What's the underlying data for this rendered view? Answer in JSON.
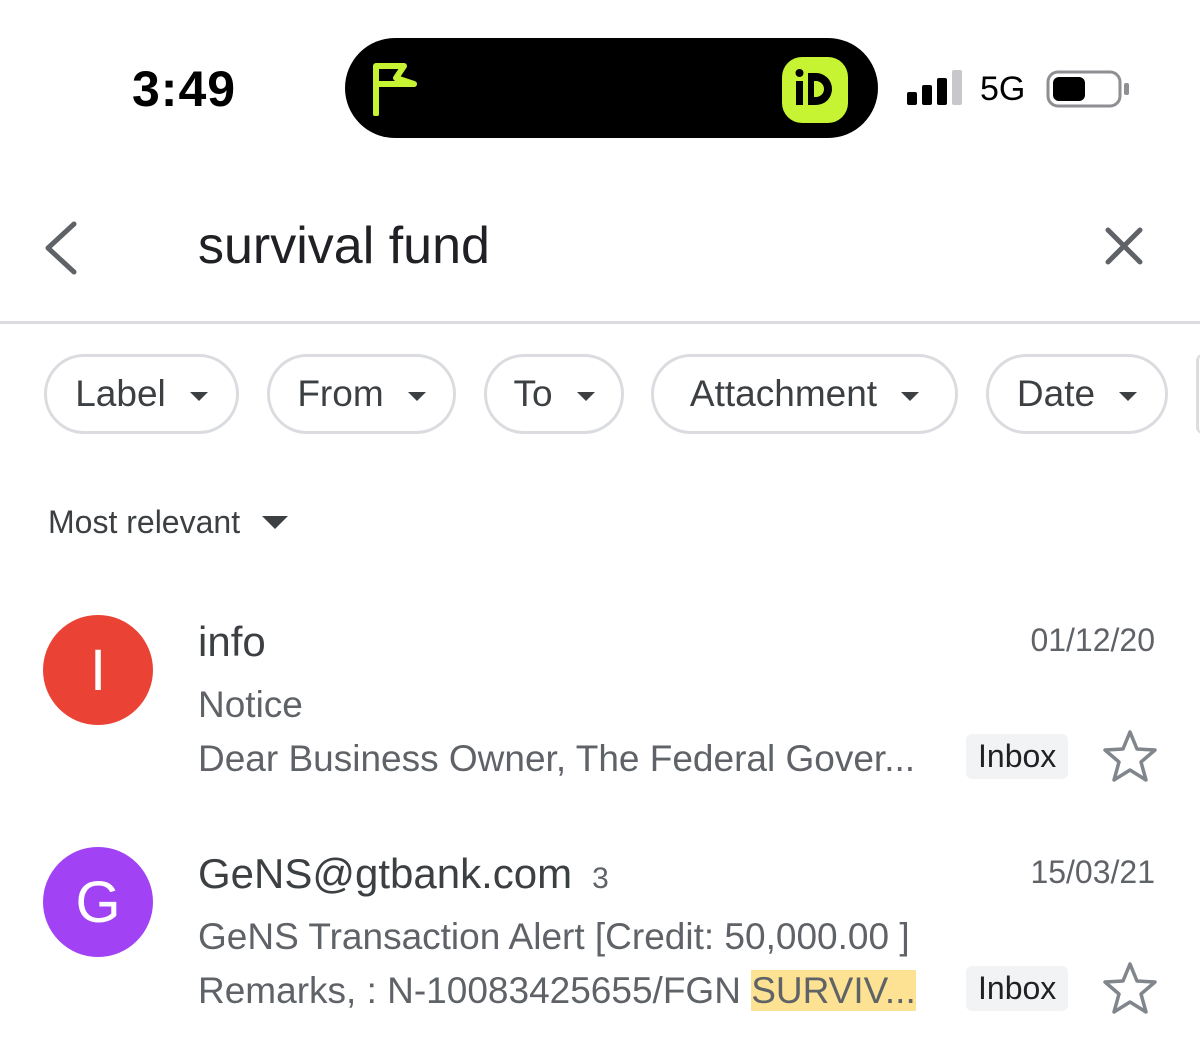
{
  "status_bar": {
    "time": "3:49",
    "network": "5G",
    "island_icons": [
      "flag-icon",
      "id-app-icon"
    ],
    "accent": "#c6f432"
  },
  "search": {
    "query": "survival fund"
  },
  "filters": [
    {
      "label": "Label"
    },
    {
      "label": "From"
    },
    {
      "label": "To"
    },
    {
      "label": "Attachment"
    },
    {
      "label": "Date"
    }
  ],
  "sort": {
    "label": "Most relevant"
  },
  "results": [
    {
      "avatar_letter": "I",
      "avatar_color": "#ea4335",
      "sender": "info",
      "count": "",
      "date": "01/12/20",
      "subject": "Notice",
      "snippet": "Dear Business Owner, The Federal Gover...",
      "snippet_highlight": "",
      "label": "Inbox",
      "starred": false
    },
    {
      "avatar_letter": "G",
      "avatar_color": "#a142f4",
      "sender": "GeNS@gtbank.com",
      "count": "3",
      "date": "15/03/21",
      "subject": "GeNS Transaction Alert [Credit: 50,000.00 ]",
      "snippet": "Remarks, : N-10083425655/FGN ",
      "snippet_highlight": "SURVIV...",
      "label": "Inbox",
      "starred": false
    }
  ]
}
